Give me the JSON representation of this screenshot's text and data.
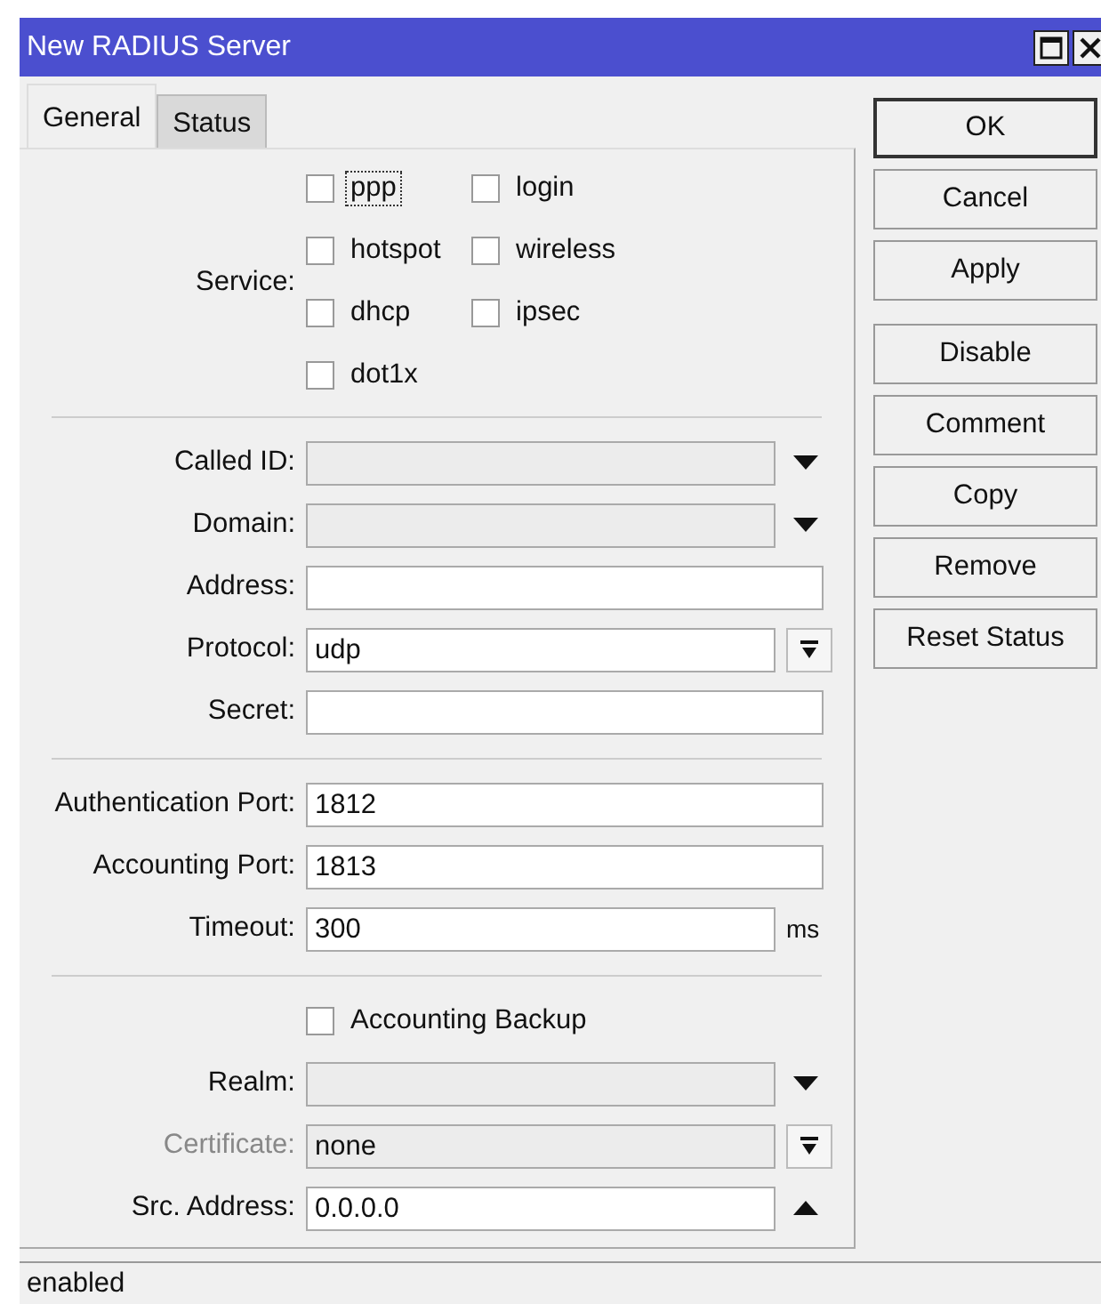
{
  "window": {
    "title": "New RADIUS Server"
  },
  "tabs": [
    {
      "label": "General",
      "selected": true
    },
    {
      "label": "Status",
      "selected": false
    }
  ],
  "sections": [
    {
      "rows": [
        {
          "kind": "checkgroup",
          "label": "Service:",
          "options": [
            {
              "label": "ppp",
              "checked": false,
              "focused": true
            },
            {
              "label": "login",
              "checked": false,
              "focused": false
            },
            {
              "label": "hotspot",
              "checked": false,
              "focused": false
            },
            {
              "label": "wireless",
              "checked": false,
              "focused": false
            },
            {
              "label": "dhcp",
              "checked": false,
              "focused": false
            },
            {
              "label": "ipsec",
              "checked": false,
              "focused": false
            },
            {
              "label": "dot1x",
              "checked": false,
              "focused": false
            }
          ]
        }
      ]
    },
    {
      "rows": [
        {
          "kind": "dropdown",
          "label": "Called ID:",
          "disabled": false
        },
        {
          "kind": "dropdown",
          "label": "Domain:",
          "disabled": false
        },
        {
          "kind": "text",
          "label": "Address:",
          "disabled": false
        },
        {
          "kind": "select",
          "label": "Protocol:",
          "value": "udp",
          "disabled": false
        },
        {
          "kind": "text",
          "label": "Secret:",
          "disabled": false
        }
      ]
    },
    {
      "rows": [
        {
          "kind": "text",
          "label": "Authentication Port:",
          "value": "1812",
          "disabled": false
        },
        {
          "kind": "text",
          "label": "Accounting Port:",
          "value": "1813",
          "disabled": false
        },
        {
          "kind": "unit",
          "label": "Timeout:",
          "value": "300",
          "unit": "ms",
          "disabled": false
        }
      ]
    },
    {
      "rows": [
        {
          "kind": "checkbox",
          "label": "Accounting Backup",
          "checked": false
        },
        {
          "kind": "dropdown",
          "label": "Realm:",
          "disabled": false
        },
        {
          "kind": "select",
          "label": "Certificate:",
          "value": "none",
          "disabled": true
        },
        {
          "kind": "updown",
          "label": "Src. Address:",
          "value": "0.0.0.0",
          "disabled": false
        }
      ]
    }
  ],
  "button_groups": [
    [
      {
        "label": "OK",
        "default": true
      },
      {
        "label": "Cancel",
        "default": false
      },
      {
        "label": "Apply",
        "default": false
      }
    ],
    [
      {
        "label": "Disable",
        "default": false
      },
      {
        "label": "Comment",
        "default": false
      },
      {
        "label": "Copy",
        "default": false
      },
      {
        "label": "Remove",
        "default": false
      },
      {
        "label": "Reset Status",
        "default": false
      }
    ]
  ],
  "status_bar": "enabled"
}
